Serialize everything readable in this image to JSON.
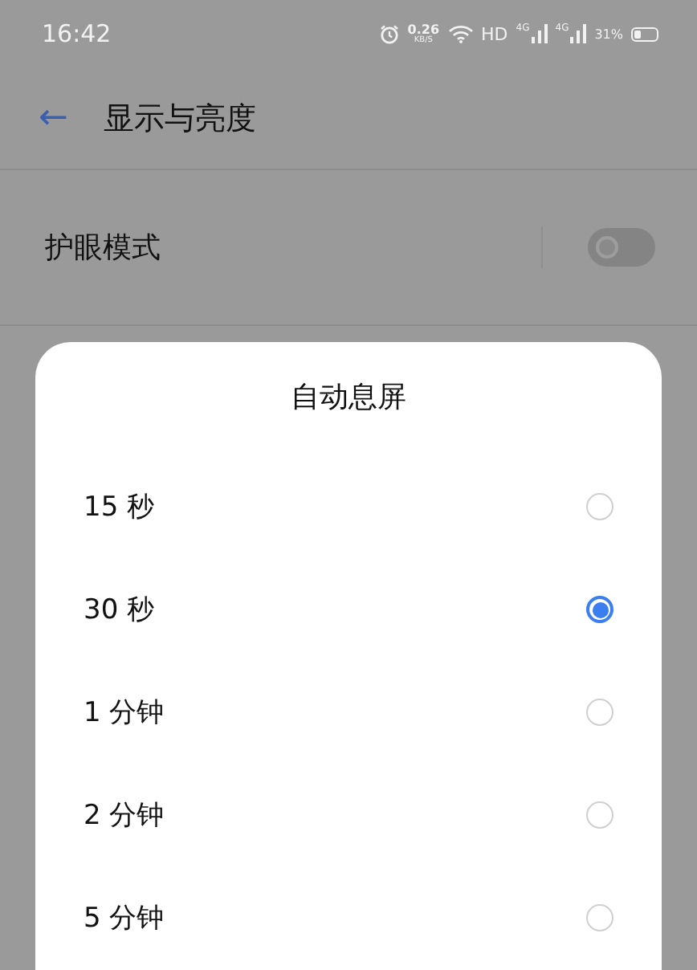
{
  "status_bar": {
    "time": "16:42",
    "speed": "0.26",
    "speed_unit": "KB/S",
    "hd": "HD",
    "network_1": "4G",
    "network_2": "4G",
    "battery": "31%"
  },
  "header": {
    "back": "←",
    "title": "显示与亮度"
  },
  "settings": [
    {
      "label": "护眼模式",
      "on": false
    }
  ],
  "dialog": {
    "title": "自动息屏",
    "options": [
      {
        "label": "15 秒",
        "selected": false
      },
      {
        "label": "30 秒",
        "selected": true
      },
      {
        "label": "1 分钟",
        "selected": false
      },
      {
        "label": "2 分钟",
        "selected": false
      },
      {
        "label": "5 分钟",
        "selected": false
      }
    ]
  }
}
